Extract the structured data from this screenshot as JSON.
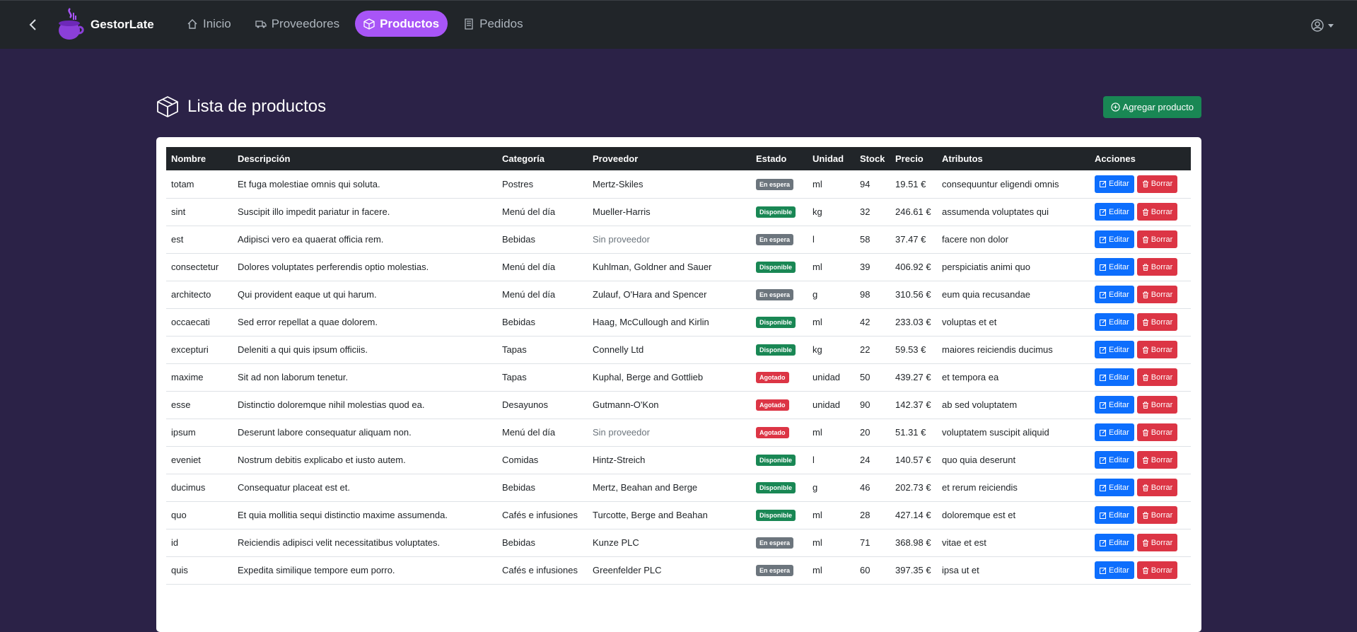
{
  "nav": {
    "brand": "GestorLate",
    "links": [
      {
        "label": "Inicio",
        "icon": "house-icon"
      },
      {
        "label": "Proveedores",
        "icon": "truck-icon"
      },
      {
        "label": "Productos",
        "icon": "box-icon",
        "active": true
      },
      {
        "label": "Pedidos",
        "icon": "receipt-icon"
      }
    ]
  },
  "header": {
    "title": "Lista de productos",
    "add_label": "Agregar producto"
  },
  "table": {
    "columns": [
      "Nombre",
      "Descripción",
      "Categoría",
      "Proveedor",
      "Estado",
      "Unidad",
      "Stock",
      "Precio",
      "Atributos",
      "Acciones"
    ],
    "edit_label": "Editar",
    "delete_label": "Borrar",
    "rows": [
      {
        "nombre": "totam",
        "descripcion": "Et fuga molestiae omnis qui soluta.",
        "categoria": "Postres",
        "proveedor": "Mertz-Skiles",
        "estado": "En espera",
        "unidad": "ml",
        "stock": "94",
        "precio": "19.51 €",
        "atributos": "consequuntur eligendi omnis"
      },
      {
        "nombre": "sint",
        "descripcion": "Suscipit illo impedit pariatur in facere.",
        "categoria": "Menú del día",
        "proveedor": "Mueller-Harris",
        "estado": "Disponible",
        "unidad": "kg",
        "stock": "32",
        "precio": "246.61 €",
        "atributos": "assumenda voluptates qui"
      },
      {
        "nombre": "est",
        "descripcion": "Adipisci vero ea quaerat officia rem.",
        "categoria": "Bebidas",
        "proveedor": "Sin proveedor",
        "estado": "En espera",
        "unidad": "l",
        "stock": "58",
        "precio": "37.47 €",
        "atributos": "facere non dolor"
      },
      {
        "nombre": "consectetur",
        "descripcion": "Dolores voluptates perferendis optio molestias.",
        "categoria": "Menú del día",
        "proveedor": "Kuhlman, Goldner and Sauer",
        "estado": "Disponible",
        "unidad": "ml",
        "stock": "39",
        "precio": "406.92 €",
        "atributos": "perspiciatis animi quo"
      },
      {
        "nombre": "architecto",
        "descripcion": "Qui provident eaque ut qui harum.",
        "categoria": "Menú del día",
        "proveedor": "Zulauf, O'Hara and Spencer",
        "estado": "En espera",
        "unidad": "g",
        "stock": "98",
        "precio": "310.56 €",
        "atributos": "eum quia recusandae"
      },
      {
        "nombre": "occaecati",
        "descripcion": "Sed error repellat a quae dolorem.",
        "categoria": "Bebidas",
        "proveedor": "Haag, McCullough and Kirlin",
        "estado": "Disponible",
        "unidad": "ml",
        "stock": "42",
        "precio": "233.03 €",
        "atributos": "voluptas et et"
      },
      {
        "nombre": "excepturi",
        "descripcion": "Deleniti a qui quis ipsum officiis.",
        "categoria": "Tapas",
        "proveedor": "Connelly Ltd",
        "estado": "Disponible",
        "unidad": "kg",
        "stock": "22",
        "precio": "59.53 €",
        "atributos": "maiores reiciendis ducimus"
      },
      {
        "nombre": "maxime",
        "descripcion": "Sit ad non laborum tenetur.",
        "categoria": "Tapas",
        "proveedor": "Kuphal, Berge and Gottlieb",
        "estado": "Agotado",
        "unidad": "unidad",
        "stock": "50",
        "precio": "439.27 €",
        "atributos": "et tempora ea"
      },
      {
        "nombre": "esse",
        "descripcion": "Distinctio doloremque nihil molestias quod ea.",
        "categoria": "Desayunos",
        "proveedor": "Gutmann-O'Kon",
        "estado": "Agotado",
        "unidad": "unidad",
        "stock": "90",
        "precio": "142.37 €",
        "atributos": "ab sed voluptatem"
      },
      {
        "nombre": "ipsum",
        "descripcion": "Deserunt labore consequatur aliquam non.",
        "categoria": "Menú del día",
        "proveedor": "Sin proveedor",
        "estado": "Agotado",
        "unidad": "ml",
        "stock": "20",
        "precio": "51.31 €",
        "atributos": "voluptatem suscipit aliquid"
      },
      {
        "nombre": "eveniet",
        "descripcion": "Nostrum debitis explicabo et iusto autem.",
        "categoria": "Comidas",
        "proveedor": "Hintz-Streich",
        "estado": "Disponible",
        "unidad": "l",
        "stock": "24",
        "precio": "140.57 €",
        "atributos": "quo quia deserunt"
      },
      {
        "nombre": "ducimus",
        "descripcion": "Consequatur placeat est et.",
        "categoria": "Bebidas",
        "proveedor": "Mertz, Beahan and Berge",
        "estado": "Disponible",
        "unidad": "g",
        "stock": "46",
        "precio": "202.73 €",
        "atributos": "et rerum reiciendis"
      },
      {
        "nombre": "quo",
        "descripcion": "Et quia mollitia sequi distinctio maxime assumenda.",
        "categoria": "Cafés e infusiones",
        "proveedor": "Turcotte, Berge and Beahan",
        "estado": "Disponible",
        "unidad": "ml",
        "stock": "28",
        "precio": "427.14 €",
        "atributos": "doloremque est et"
      },
      {
        "nombre": "id",
        "descripcion": "Reiciendis adipisci velit necessitatibus voluptates.",
        "categoria": "Bebidas",
        "proveedor": "Kunze PLC",
        "estado": "En espera",
        "unidad": "ml",
        "stock": "71",
        "precio": "368.98 €",
        "atributos": "vitae et est"
      },
      {
        "nombre": "quis",
        "descripcion": "Expedita similique tempore eum porro.",
        "categoria": "Cafés e infusiones",
        "proveedor": "Greenfelder PLC",
        "estado": "En espera",
        "unidad": "ml",
        "stock": "60",
        "precio": "397.35 €",
        "atributos": "ipsa ut et"
      }
    ]
  },
  "colors": {
    "background": "#2b2247",
    "navbar": "#212529",
    "active_pill": "#a855f7",
    "success": "#198754",
    "primary": "#0d6efd",
    "danger": "#dc3545",
    "secondary": "#6c757d"
  }
}
